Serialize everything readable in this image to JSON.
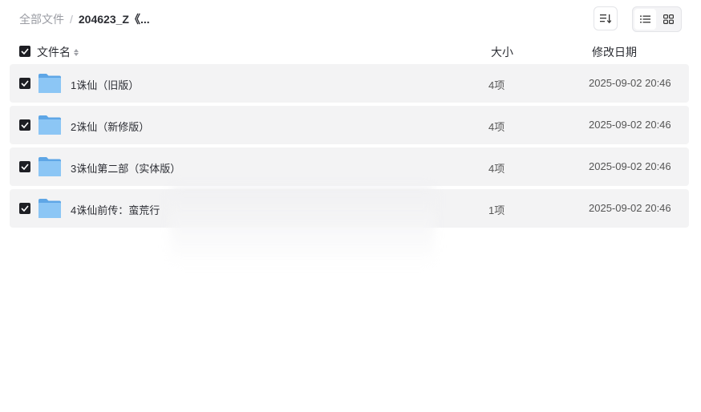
{
  "breadcrumb": {
    "root": "全部文件",
    "separator": "/",
    "current": "204623_Z《..."
  },
  "toolbar": {
    "sort_icon": "sort-lines-icon",
    "view_list_icon": "list-view-icon",
    "view_grid_icon": "grid-view-icon",
    "active_view": "list"
  },
  "table": {
    "headers": {
      "name": "文件名",
      "size": "大小",
      "date": "修改日期"
    },
    "rows": [
      {
        "name": "1诛仙（旧版）",
        "size": "4项",
        "date": "2025-09-02 20:46",
        "checked": true
      },
      {
        "name": "2诛仙（新修版）",
        "size": "4项",
        "date": "2025-09-02 20:46",
        "checked": true
      },
      {
        "name": "3诛仙第二部（实体版）",
        "size": "4项",
        "date": "2025-09-02 20:46",
        "checked": true
      },
      {
        "name": "4诛仙前传：蛮荒行",
        "size": "1项",
        "date": "2025-09-02 20:46",
        "checked": true
      }
    ]
  },
  "colors": {
    "row_bg": "#f3f3f4",
    "checkbox": "#1e1f24",
    "folder": "#7cbcf2"
  }
}
